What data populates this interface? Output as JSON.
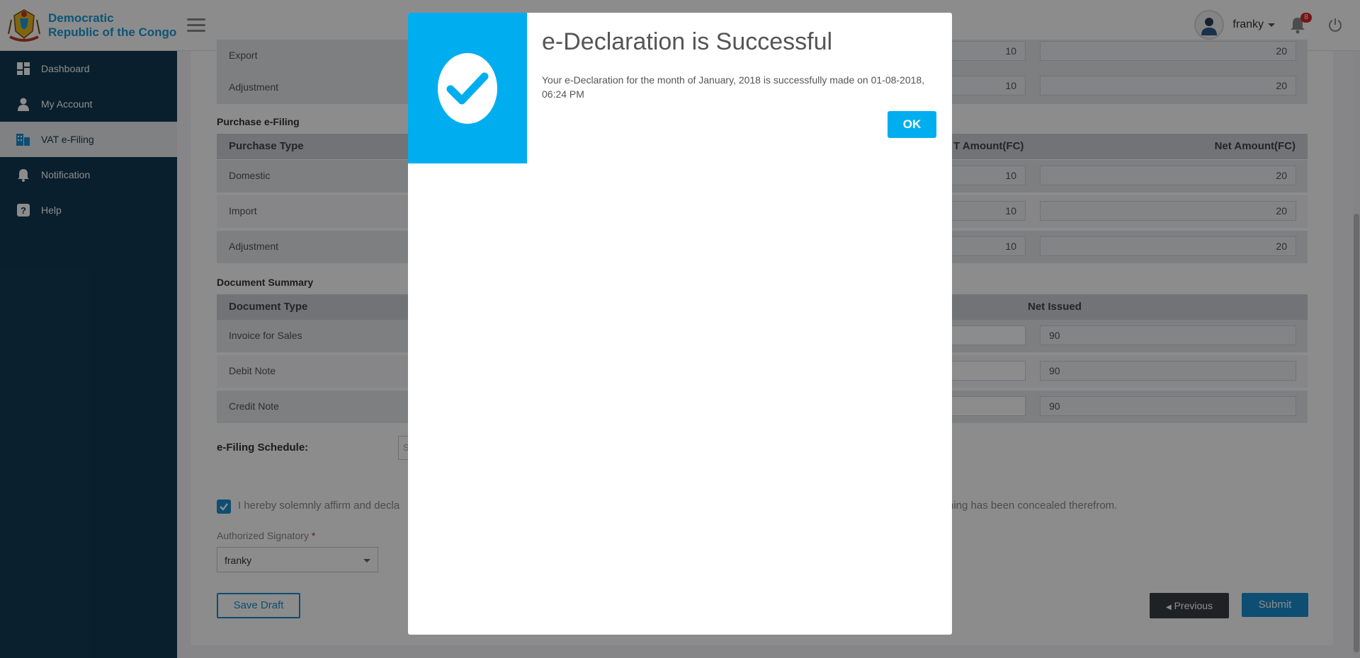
{
  "brand": {
    "name_line1": "Democratic",
    "name_line2": "Republic of the Congo"
  },
  "sidebar": {
    "items": [
      {
        "label": "Dashboard",
        "icon": "dashboard-icon"
      },
      {
        "label": "My Account",
        "icon": "user-icon"
      },
      {
        "label": "VAT e-Filing",
        "icon": "vat-filing-icon",
        "active": true
      },
      {
        "label": "Notification",
        "icon": "bell-icon"
      },
      {
        "label": "Help",
        "icon": "help-icon"
      }
    ]
  },
  "header": {
    "user_name": "franky",
    "notification_count": "8"
  },
  "sales": {
    "rows": [
      {
        "label": "Export",
        "vat": "10",
        "net": "20"
      },
      {
        "label": "Adjustment",
        "vat": "10",
        "net": "20"
      }
    ]
  },
  "purchase": {
    "title": "Purchase e-Filing",
    "headers": {
      "type": "Purchase Type",
      "vat": "T Amount(FC)",
      "net": "Net Amount(FC)"
    },
    "rows": [
      {
        "label": "Domestic",
        "vat": "10",
        "net": "20"
      },
      {
        "label": "Import",
        "vat": "10",
        "net": "20"
      },
      {
        "label": "Adjustment",
        "vat": "10",
        "net": "20"
      }
    ]
  },
  "documents": {
    "title": "Document Summary",
    "headers": {
      "type": "Document Type",
      "net": "Net Issued"
    },
    "rows": [
      {
        "label": "Invoice for Sales",
        "net": "90"
      },
      {
        "label": "Debit Note",
        "net": "90"
      },
      {
        "label": "Credit Note",
        "net": "90"
      }
    ]
  },
  "schedule": {
    "label": "e-Filing Schedule:",
    "value": "S"
  },
  "affirmation": {
    "left": "I hereby solemnly affirm and decla",
    "right": "hing has been concealed therefrom."
  },
  "signatory": {
    "label": "Authorized Signatory",
    "required": "*",
    "value": "franky"
  },
  "buttons": {
    "save_draft": "Save Draft",
    "previous": "Previous",
    "submit": "Submit"
  },
  "modal": {
    "title": "e-Declaration is Successful",
    "message": "Your e-Declaration for the month of January, 2018 is successfully made on 01-08-2018, 06:24 PM",
    "ok": "OK"
  },
  "colors": {
    "sidebar": "#123a53",
    "accent": "#00aeef",
    "primary": "#1a8fcf"
  }
}
